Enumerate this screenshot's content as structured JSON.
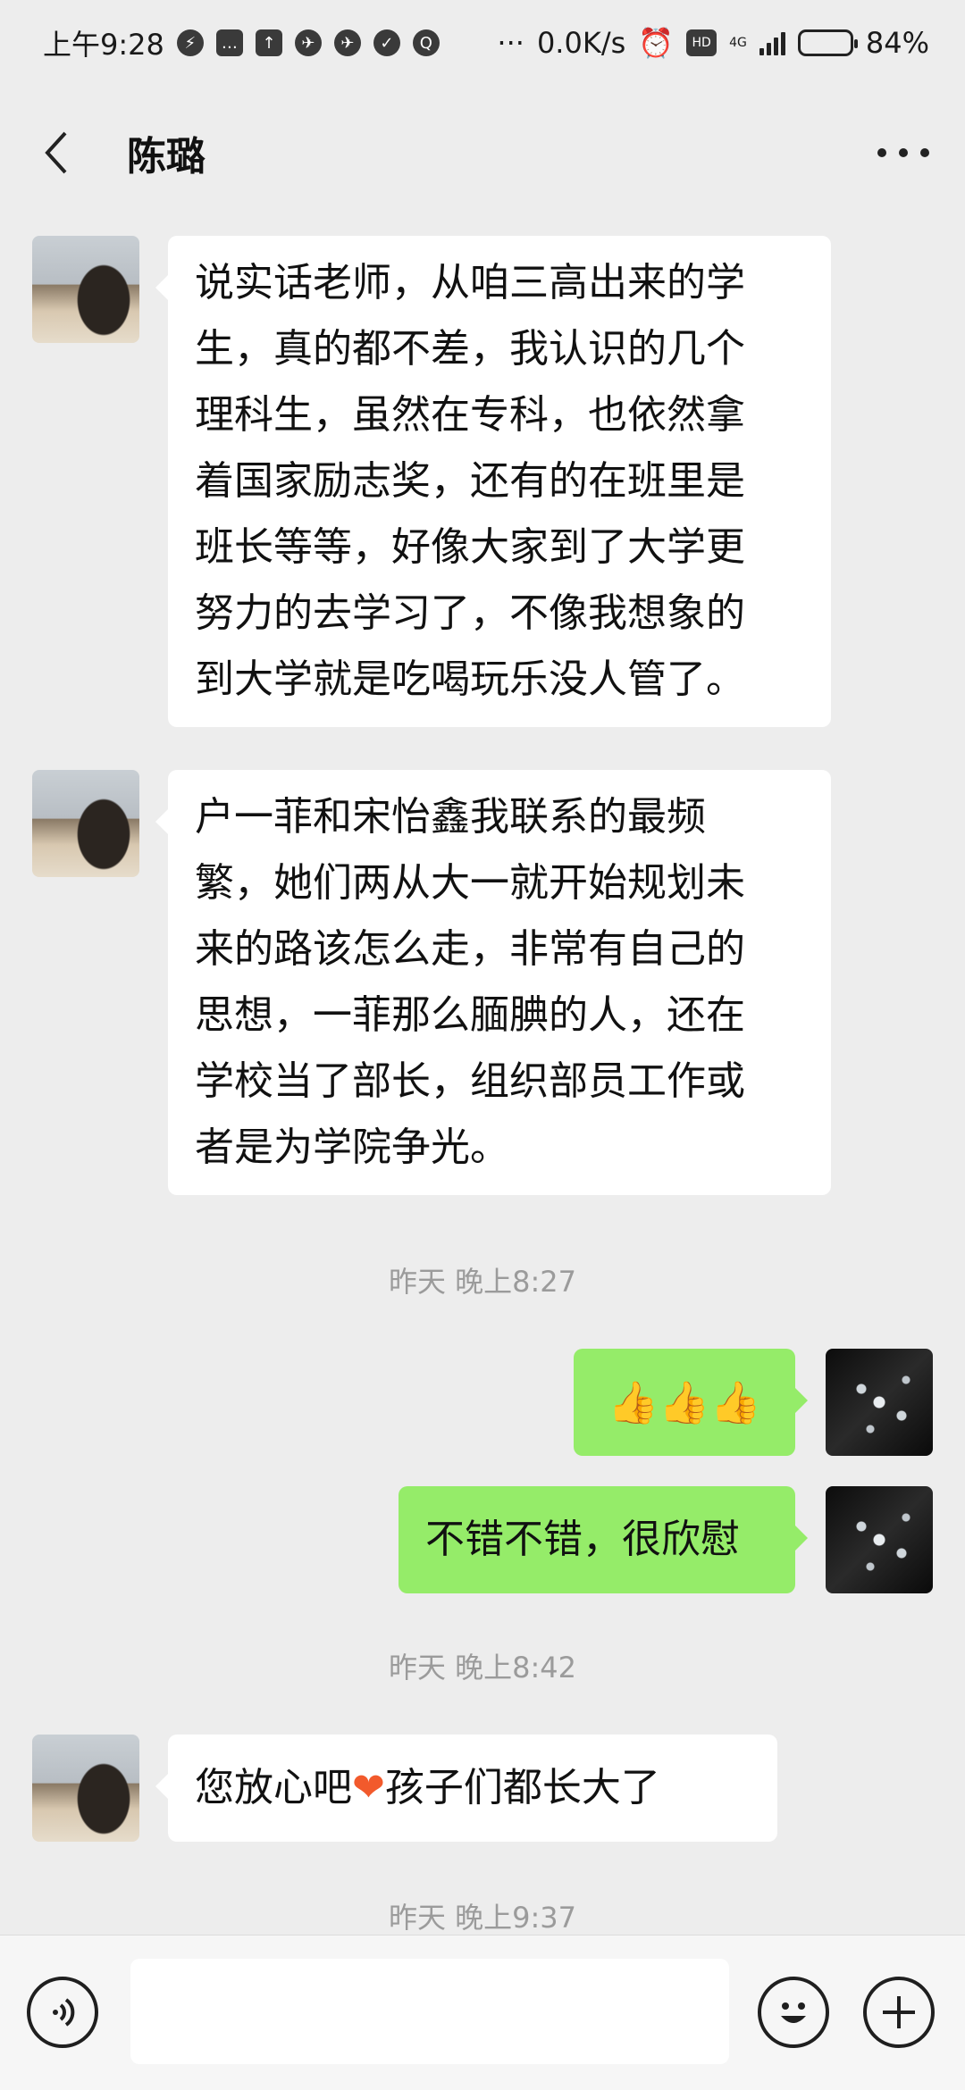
{
  "status_bar": {
    "time": "上午9:28",
    "dots": "···",
    "net_speed": "0.0K/s",
    "hd": "HD",
    "network": "4G",
    "battery": "84%"
  },
  "header": {
    "title": "陈璐"
  },
  "messages": [
    {
      "side": "in",
      "text": "说实话老师，从咱三高出来的学\n生，真的都不差，我认识的几个\n理科生，虽然在专科，也依然拿\n着国家励志奖，还有的在班里是\n班长等等，好像大家到了大学更\n努力的去学习了，不像我想象的\n到大学就是吃喝玩乐没人管了。"
    },
    {
      "side": "in",
      "text": "户一菲和宋怡鑫我联系的最频\n繁，她们两从大一就开始规划未\n来的路该怎么走，非常有自己的\n思想，一菲那么腼腆的人，还在\n学校当了部长，组织部员工作或\n者是为学院争光。"
    },
    {
      "side": "out",
      "text": "👍👍👍"
    },
    {
      "side": "out",
      "text": "不错不错，很欣慰"
    },
    {
      "side": "in",
      "text_before": "您放心吧",
      "emoji": "❤",
      "text_after": "孩子们都长大了"
    }
  ],
  "timestamps": [
    "昨天 晚上8:27",
    "昨天 晚上8:42",
    "昨天 晚上9:37"
  ],
  "input": {
    "placeholder": ""
  },
  "colors": {
    "background": "#ededed",
    "incoming_bubble": "#ffffff",
    "outgoing_bubble": "#95ec69",
    "timestamp": "#9b9b9b"
  },
  "icons": [
    "voice-icon",
    "emoji-icon",
    "plus-icon",
    "back-icon",
    "more-icon"
  ]
}
